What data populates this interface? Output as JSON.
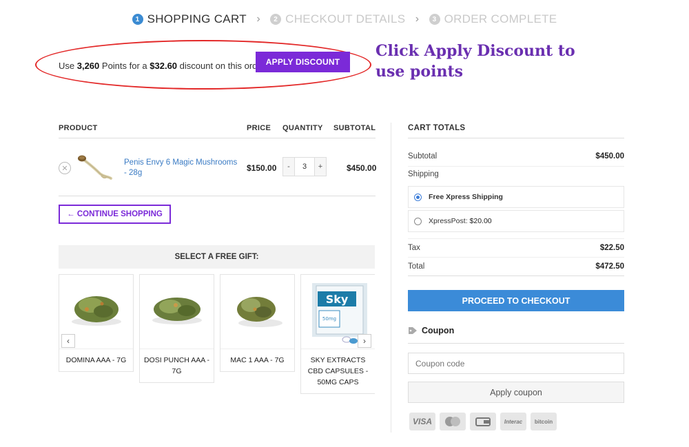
{
  "steps": [
    {
      "num": "1",
      "label": "SHOPPING CART"
    },
    {
      "num": "2",
      "label": "CHECKOUT DETAILS"
    },
    {
      "num": "3",
      "label": "ORDER COMPLETE"
    }
  ],
  "points_banner": {
    "pre": "Use ",
    "points": "3,260",
    "mid": " Points for a ",
    "amount": "$32.60",
    "post": " discount on this order!",
    "button": "APPLY DISCOUNT"
  },
  "annotation": "Click Apply Discount to use points",
  "cart_table": {
    "headers": {
      "product": "PRODUCT",
      "price": "PRICE",
      "quantity": "QUANTITY",
      "subtotal": "SUBTOTAL"
    },
    "items": [
      {
        "name": "Penis Envy 6 Magic Mushrooms - 28g",
        "price": "$150.00",
        "qty": "3",
        "subtotal": "$450.00"
      }
    ],
    "remove_symbol": "✕",
    "minus": "-",
    "plus": "+"
  },
  "continue_button": "← CONTINUE SHOPPING",
  "gifts": {
    "title": "SELECT A FREE GIFT:",
    "items": [
      {
        "name": "DOMINA AAA - 7G"
      },
      {
        "name": "DOSI PUNCH AAA - 7G"
      },
      {
        "name": "MAC 1 AAA - 7G"
      },
      {
        "name": "SKY EXTRACTS CBD CAPSULES - 50MG CAPS"
      }
    ],
    "prev": "‹",
    "next": "›",
    "sky_text": "Sky",
    "sky_sub": "50mg"
  },
  "totals": {
    "title": "CART TOTALS",
    "subtotal_label": "Subtotal",
    "subtotal_value": "$450.00",
    "shipping_label": "Shipping",
    "shipping_options": [
      {
        "label": "Free Xpress Shipping",
        "price": "",
        "selected": true
      },
      {
        "label": "XpressPost: ",
        "price": "$20.00",
        "selected": false
      }
    ],
    "tax_label": "Tax",
    "tax_value": "$22.50",
    "total_label": "Total",
    "total_value": "$472.50",
    "proceed_button": "PROCEED TO CHECKOUT"
  },
  "coupon": {
    "title": "Coupon",
    "placeholder": "Coupon code",
    "button": "Apply coupon"
  },
  "payment_icons": [
    "VISA",
    "MasterCard",
    "wallet",
    "Interac",
    "bitcoin"
  ],
  "payment_icon_labels": {
    "visa": "VISA",
    "interac": "Interac",
    "bitcoin": "bitcoin"
  },
  "colors": {
    "accent_purple": "#7b2ad8",
    "checkout_blue": "#3b8bd8",
    "annotation_red": "#e32929",
    "link_blue": "#3a7bc4"
  }
}
